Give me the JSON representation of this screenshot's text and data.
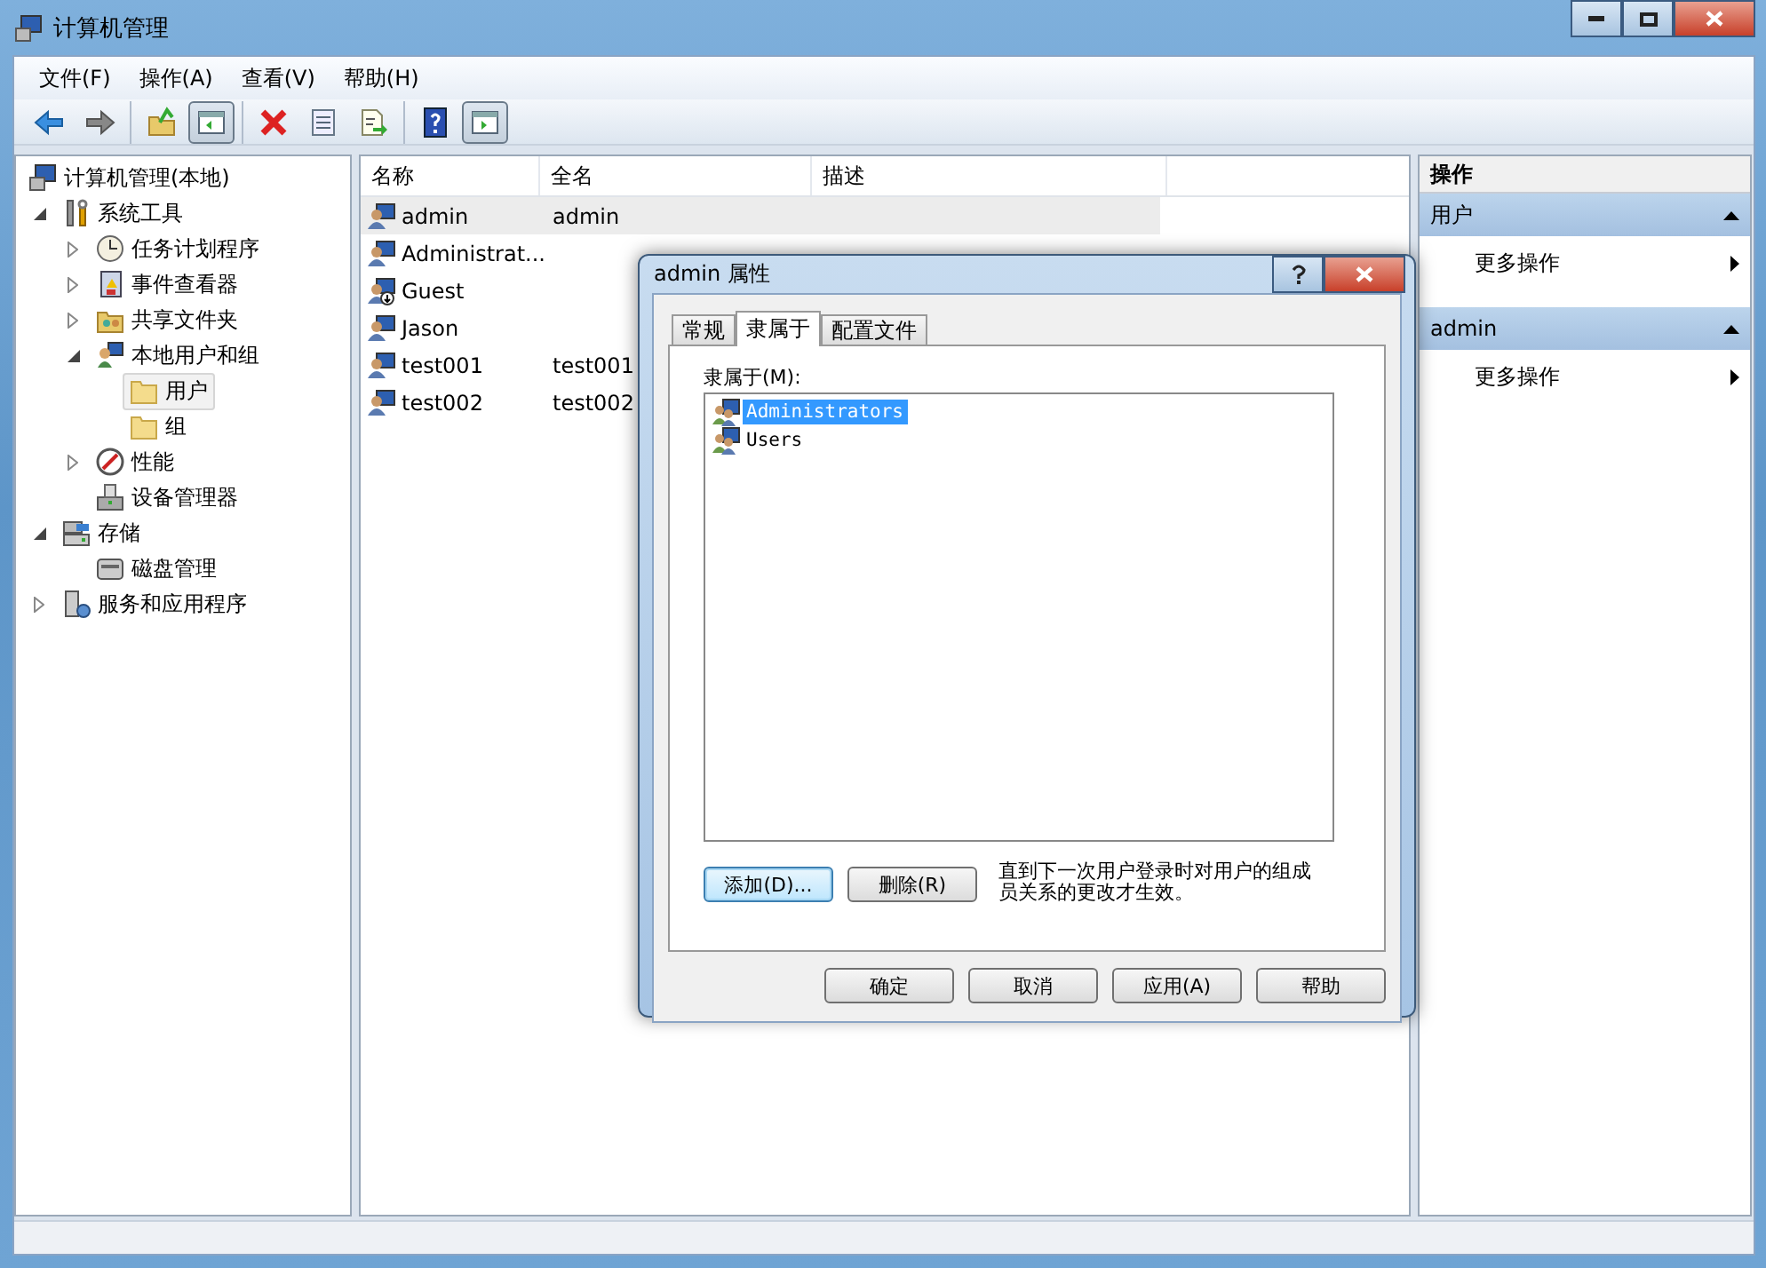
{
  "window": {
    "title": "计算机管理"
  },
  "menu": [
    "文件(F)",
    "操作(A)",
    "查看(V)",
    "帮助(H)"
  ],
  "toolbar_groups": [
    {
      "buttons": [
        {
          "kind": "back",
          "pressed": false
        },
        {
          "kind": "forward",
          "pressed": false
        }
      ]
    },
    {
      "buttons": [
        {
          "kind": "up",
          "pressed": false
        },
        {
          "kind": "tree-pane",
          "pressed": true
        }
      ]
    },
    {
      "buttons": [
        {
          "kind": "delete",
          "pressed": false
        },
        {
          "kind": "properties",
          "pressed": false
        },
        {
          "kind": "export",
          "pressed": false
        }
      ]
    },
    {
      "buttons": [
        {
          "kind": "help",
          "pressed": false
        },
        {
          "kind": "action-pane",
          "pressed": true
        }
      ]
    }
  ],
  "tree": [
    {
      "label": "计算机管理(本地)",
      "kind": "computer",
      "selected": false,
      "children": [
        {
          "label": "系统工具",
          "kind": "tools",
          "selected": false,
          "expanded": true,
          "children": [
            {
              "label": "任务计划程序",
              "kind": "clock",
              "selected": false,
              "expanded": false
            },
            {
              "label": "事件查看器",
              "kind": "log",
              "selected": false,
              "expanded": false
            },
            {
              "label": "共享文件夹",
              "kind": "share",
              "selected": false,
              "expanded": false
            },
            {
              "label": "本地用户和组",
              "kind": "users",
              "selected": false,
              "expanded": true,
              "children": [
                {
                  "label": "用户",
                  "kind": "folder",
                  "selected": true
                },
                {
                  "label": "组",
                  "kind": "folder",
                  "selected": false
                }
              ]
            },
            {
              "label": "性能",
              "kind": "gauge",
              "selected": false,
              "expanded": false
            },
            {
              "label": "设备管理器",
              "kind": "device",
              "selected": false
            }
          ]
        },
        {
          "label": "存储",
          "kind": "storage",
          "selected": false,
          "expanded": true,
          "children": [
            {
              "label": "磁盘管理",
              "kind": "disk",
              "selected": false
            }
          ]
        },
        {
          "label": "服务和应用程序",
          "kind": "services",
          "selected": false,
          "expanded": false
        }
      ]
    }
  ],
  "users": {
    "columns": [
      "名称",
      "全名",
      "描述"
    ],
    "rows": [
      {
        "name": "admin",
        "full_name": "admin",
        "selected": true
      },
      {
        "name": "Administrat...",
        "selected": false
      },
      {
        "name": "Guest",
        "disabled": true,
        "selected": false
      },
      {
        "name": "Jason",
        "selected": false
      },
      {
        "name": "test001",
        "full_name": "test001",
        "selected": false
      },
      {
        "name": "test002",
        "full_name": "test002",
        "selected": false
      }
    ]
  },
  "actions": {
    "title": "操作",
    "sections": [
      {
        "title": "用户",
        "expanded": true,
        "items": [
          "更多操作"
        ]
      },
      {
        "title": "admin",
        "expanded": true,
        "items": [
          "更多操作"
        ]
      }
    ]
  },
  "dialog": {
    "title": "admin 属性",
    "tabs": [
      {
        "label": "常规",
        "selected": false
      },
      {
        "label": "隶属于",
        "selected": true
      },
      {
        "label": "配置文件",
        "selected": false
      }
    ],
    "member_label": "隶属于(M):",
    "members": [
      {
        "name": "Administrators",
        "selected": true
      },
      {
        "name": "Users",
        "selected": false
      }
    ],
    "add_button": {
      "label": "添加(D)...",
      "focused": true
    },
    "remove_button": {
      "label": "删除(R)",
      "focused": false
    },
    "note": "直到下一次用户登录时对用户的组成员关系的更改才生效。",
    "buttons": [
      "确定",
      "取消",
      "应用(A)",
      "帮助"
    ]
  }
}
